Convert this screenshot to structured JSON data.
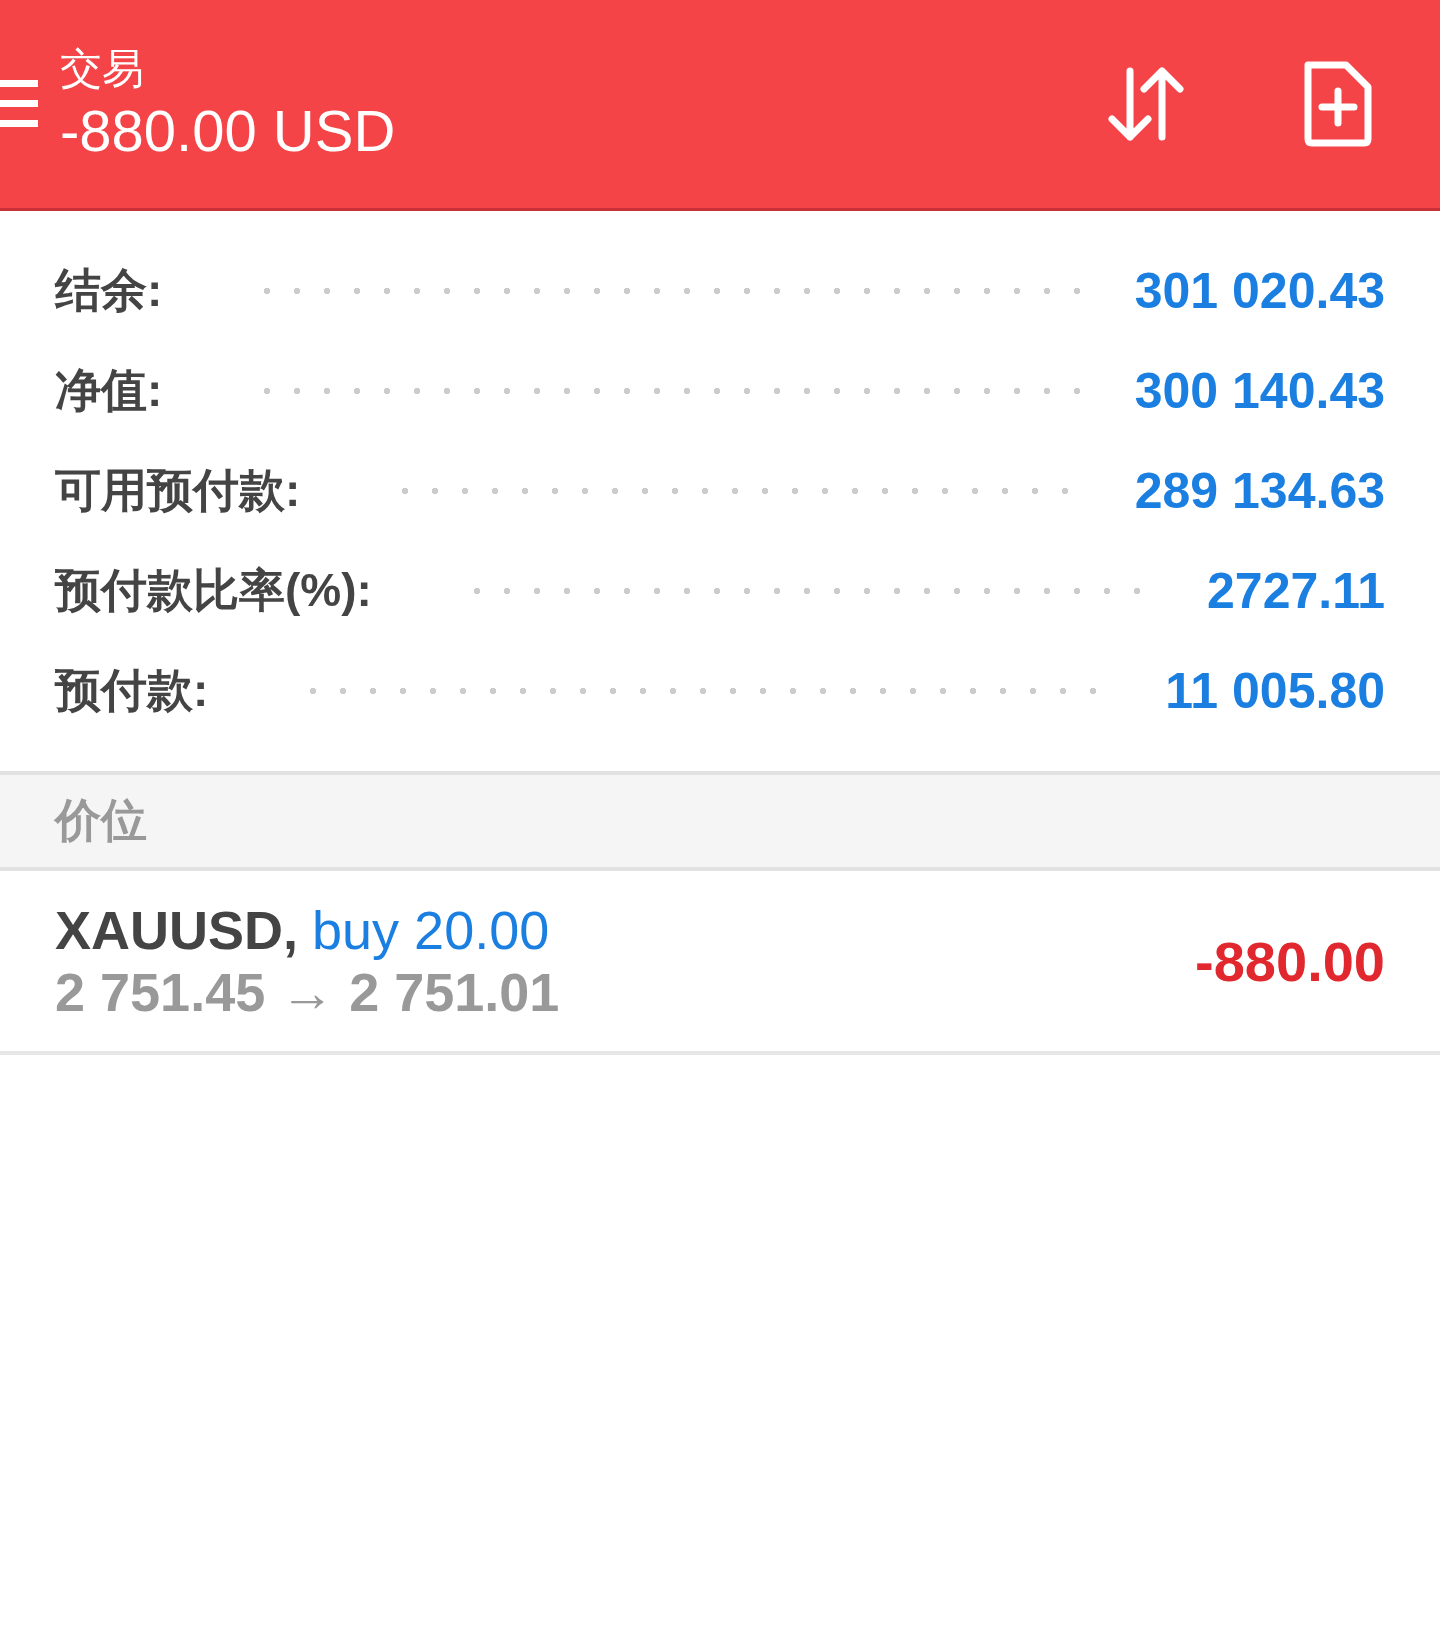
{
  "header": {
    "title": "交易",
    "subtitle": "-880.00 USD"
  },
  "summary": [
    {
      "label": "结余:",
      "value": "301 020.43"
    },
    {
      "label": "净值:",
      "value": "300 140.43"
    },
    {
      "label": "可用预付款:",
      "value": "289 134.63"
    },
    {
      "label": "预付款比率(%):",
      "value": "2727.11"
    },
    {
      "label": "预付款:",
      "value": "11 005.80"
    }
  ],
  "section": {
    "title": "价位"
  },
  "positions": [
    {
      "symbol": "XAUUSD,",
      "side": "buy 20.00",
      "prices": "2 751.45 → 2 751.01",
      "profit": "-880.00"
    }
  ]
}
